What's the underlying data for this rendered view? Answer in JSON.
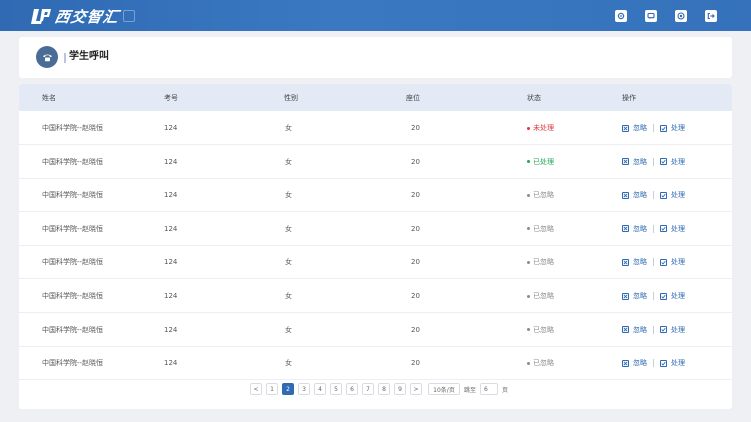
{
  "app": {
    "name": "西交智汇"
  },
  "page": {
    "title": "学生呼叫"
  },
  "colors": {
    "brand": "#2f6ab3",
    "header_bg": "#e3eaf5",
    "unprocessed": "#e0383e",
    "processed": "#27a35a",
    "ignored": "#8c8c8c"
  },
  "table": {
    "columns": {
      "name": "姓名",
      "exam_no": "考号",
      "gender": "性别",
      "seat": "座位",
      "status": "状态",
      "actions": "操作"
    },
    "action_labels": {
      "ignore": "忽略",
      "process": "处理"
    },
    "rows": [
      {
        "name": "中国科学院--赵晓恒",
        "exam_no": "124",
        "gender": "女",
        "seat": "20",
        "status": "未处理",
        "status_type": "unprocessed"
      },
      {
        "name": "中国科学院--赵晓恒",
        "exam_no": "124",
        "gender": "女",
        "seat": "20",
        "status": "已处理",
        "status_type": "processed"
      },
      {
        "name": "中国科学院--赵晓恒",
        "exam_no": "124",
        "gender": "女",
        "seat": "20",
        "status": "已忽略",
        "status_type": "ignored"
      },
      {
        "name": "中国科学院--赵晓恒",
        "exam_no": "124",
        "gender": "女",
        "seat": "20",
        "status": "已忽略",
        "status_type": "ignored"
      },
      {
        "name": "中国科学院--赵晓恒",
        "exam_no": "124",
        "gender": "女",
        "seat": "20",
        "status": "已忽略",
        "status_type": "ignored"
      },
      {
        "name": "中国科学院--赵晓恒",
        "exam_no": "124",
        "gender": "女",
        "seat": "20",
        "status": "已忽略",
        "status_type": "ignored"
      },
      {
        "name": "中国科学院--赵晓恒",
        "exam_no": "124",
        "gender": "女",
        "seat": "20",
        "status": "已忽略",
        "status_type": "ignored"
      },
      {
        "name": "中国科学院--赵晓恒",
        "exam_no": "124",
        "gender": "女",
        "seat": "20",
        "status": "已忽略",
        "status_type": "ignored"
      }
    ]
  },
  "pagination": {
    "prev": "<",
    "next": ">",
    "pages": [
      "1",
      "2",
      "3",
      "4",
      "5",
      "6",
      "7",
      "8",
      "9"
    ],
    "current": "2",
    "page_size": "10条/页",
    "jump_label": "跳至",
    "jump_value": "6",
    "page_suffix": "页"
  },
  "toolbar_icons": [
    "settings-icon",
    "message-icon",
    "help-icon",
    "logout-icon"
  ]
}
